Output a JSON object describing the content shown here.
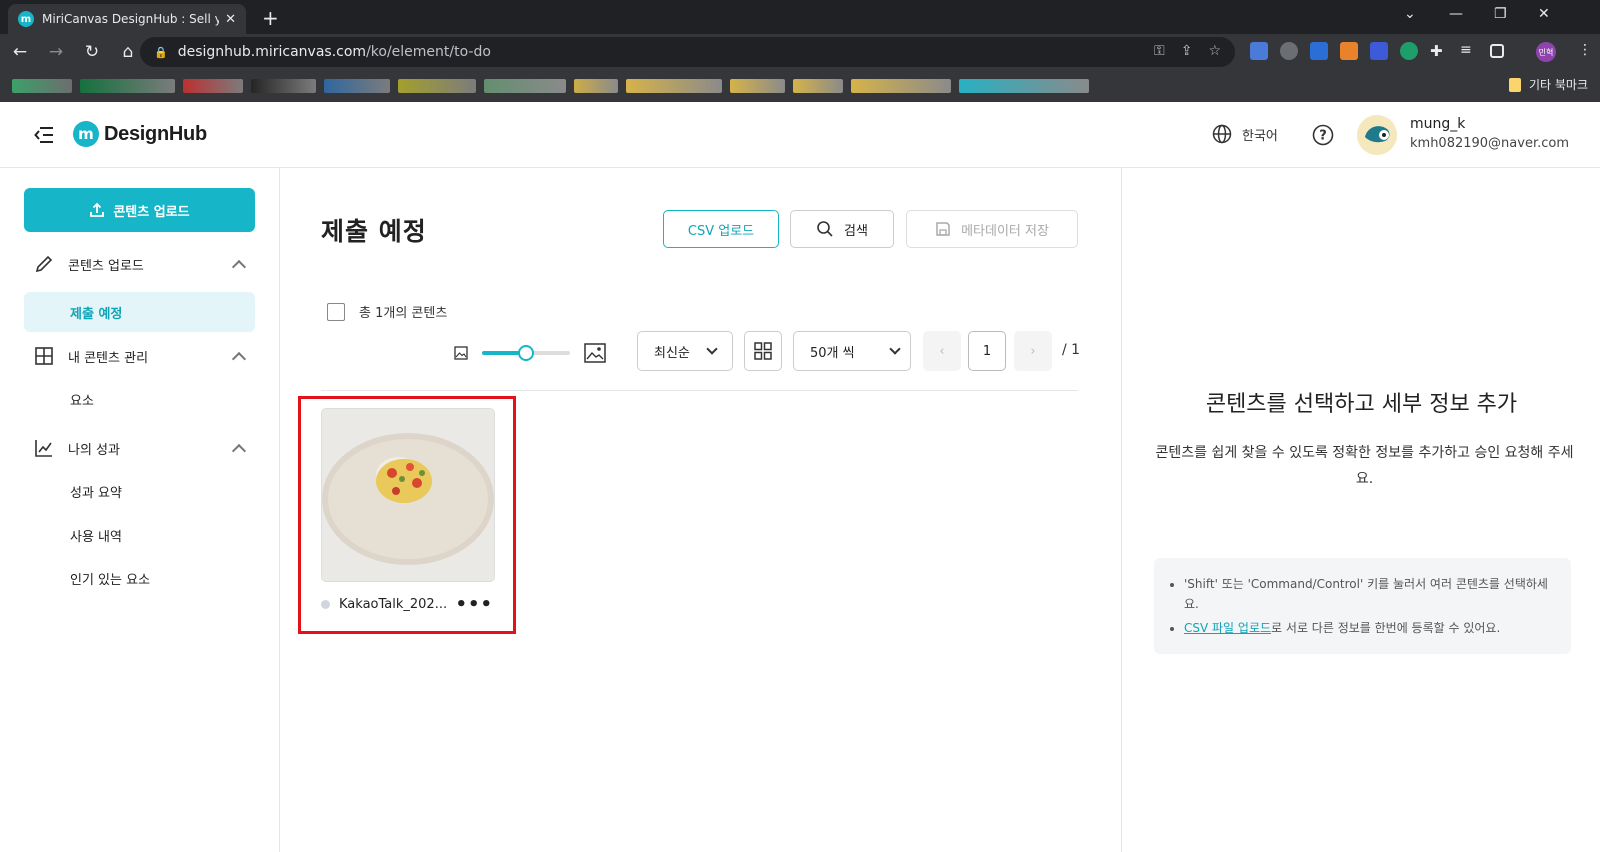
{
  "browser": {
    "tab_title": "MiriCanvas DesignHub : Sell your",
    "url_host": "designhub.miricanvas.com",
    "url_path": "/ko/element/to-do",
    "profile_label": "민혁",
    "other_bookmarks": "기타 북마크"
  },
  "header": {
    "logo_text": "DesignHub",
    "language": "한국어",
    "user_name": "mung_k",
    "user_email": "kmh082190@naver.com"
  },
  "sidebar": {
    "upload_button": "콘텐츠 업로드",
    "sections": [
      {
        "label": "콘텐츠 업로드",
        "items": [
          "제출 예정"
        ]
      },
      {
        "label": "내 콘텐츠 관리",
        "items": [
          "요소"
        ]
      },
      {
        "label": "나의 성과",
        "items": [
          "성과 요약",
          "사용 내역",
          "인기 있는 요소"
        ]
      }
    ]
  },
  "main": {
    "title": "제출 예정",
    "csv_button": "CSV 업로드",
    "search_button": "검색",
    "save_button": "메타데이터 저장",
    "select_all_label": "총 1개의 콘텐츠",
    "thumbnail_size_level": 0.5,
    "sort_value": "최신순",
    "per_page_value": "50개 씩",
    "page_current": "1",
    "page_total": "/ 1",
    "items": [
      {
        "name": "KakaoTalk_202..."
      }
    ]
  },
  "right_panel": {
    "title": "콘텐츠를 선택하고 세부 정보 추가",
    "description": "콘텐츠를 쉽게 찾을 수 있도록 정확한 정보를 추가하고 승인 요청해 주세요.",
    "tip_1": "'Shift' 또는 'Command/Control' 키를 눌러서 여러 콘텐츠를 선택하세요.",
    "tip_2_link": "CSV 파일 업로드",
    "tip_2_rest": "로 서로 다른 정보를 한번에 등록할 수 있어요."
  },
  "colors": {
    "accent": "#17b5c8",
    "highlight": "#e3121a"
  }
}
